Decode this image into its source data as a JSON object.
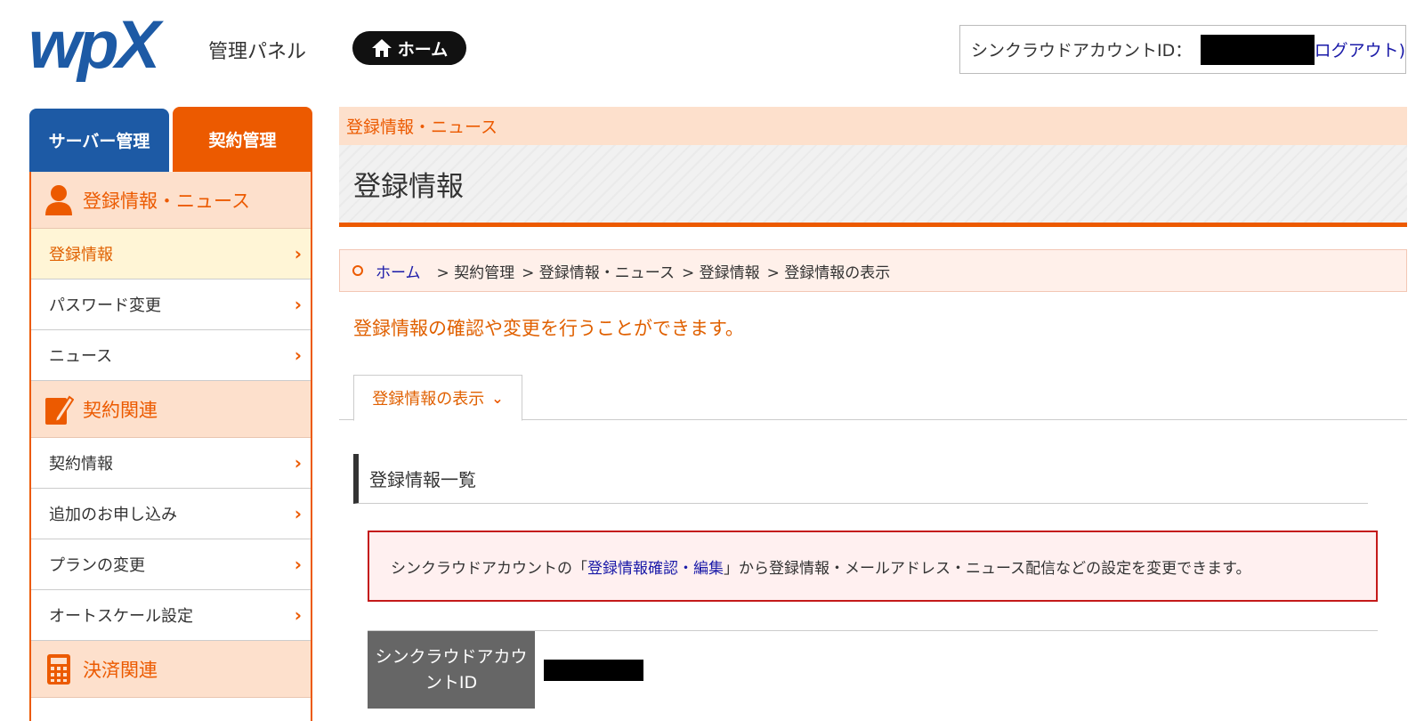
{
  "header": {
    "logo_text": "wpX",
    "panel_label": "管理パネル",
    "home_button_label": "ホーム",
    "account_label": "シンクラウドアカウントID：",
    "logout_label": "ログアウト)"
  },
  "sidebar": {
    "tabs": [
      {
        "label": "サーバー管理"
      },
      {
        "label": "契約管理"
      }
    ],
    "sections": [
      {
        "title": "登録情報・ニュース",
        "icon": "user-icon",
        "items": [
          {
            "label": "登録情報",
            "active": true
          },
          {
            "label": "パスワード変更"
          },
          {
            "label": "ニュース"
          }
        ]
      },
      {
        "title": "契約関連",
        "icon": "document-edit-icon",
        "items": [
          {
            "label": "契約情報"
          },
          {
            "label": "追加のお申し込み"
          },
          {
            "label": "プランの変更"
          },
          {
            "label": "オートスケール設定"
          }
        ]
      },
      {
        "title": "決済関連",
        "icon": "calculator-icon",
        "items": []
      }
    ]
  },
  "main": {
    "section_crumb": "登録情報・ニュース",
    "page_title": "登録情報",
    "breadcrumb": {
      "home": "ホーム",
      "items": [
        "> 契約管理",
        "> 登録情報・ニュース",
        "> 登録情報",
        "> 登録情報の表示"
      ]
    },
    "lead_text": "登録情報の確認や変更を行うことができます。",
    "subtab_label": "登録情報の表示",
    "section_title": "登録情報一覧",
    "notice": {
      "before": "シンクラウドアカウントの「",
      "link": "登録情報確認・編集",
      "after": "」から登録情報・メールアドレス・ニュース配信などの設定を変更できます。"
    },
    "table": {
      "row_label": "シンクラウドアカウントID"
    }
  },
  "colors": {
    "accent": "#ec5a00",
    "server_tab": "#1d5aa5",
    "link": "#1a1aa8",
    "notice_border": "#c41a1a"
  }
}
